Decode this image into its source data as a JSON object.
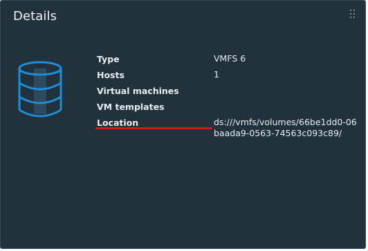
{
  "panel": {
    "title": "Details"
  },
  "properties": [
    {
      "label": "Type",
      "value": "VMFS 6"
    },
    {
      "label": "Hosts",
      "value": "1"
    },
    {
      "label": "Virtual machines",
      "value": ""
    },
    {
      "label": "VM templates",
      "value": ""
    },
    {
      "label": "Location",
      "value": "ds:///vmfs/volumes/66be1dd0-06baada9-0563-74563c093c89/"
    }
  ],
  "icons": {
    "datastore": "database-icon",
    "drag": "grip-icon"
  },
  "colors": {
    "background": "#22323d",
    "text": "#e8ecef",
    "icon_stroke": "#1b8fd9",
    "annotation": "#d21a1a"
  }
}
